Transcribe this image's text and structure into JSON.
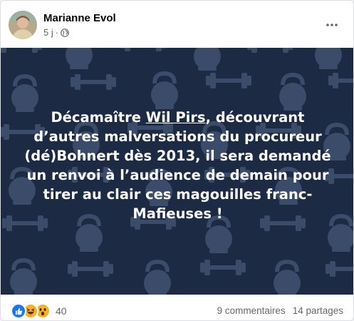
{
  "post": {
    "author": "Marianne Evol",
    "time": "5 j",
    "separator": "·",
    "audience_icon": "globe-icon",
    "more_icon": "more-options-icon",
    "text_before_tag": "Décamaître ",
    "tag": "Wil Pirs",
    "text_after_tag": ", découvrant d’autres malversations du procureur (dé)Bohnert dès 2013, il sera demandé un renvoi à l’audience de demain pour tirer au clair ces magouilles franc-Mafieuses !",
    "background_color": "#1d2a44",
    "pattern_color": "#3b4b6a",
    "text_color": "#ffffff"
  },
  "footer": {
    "reaction_icons": [
      "like-icon",
      "haha-icon",
      "wow-icon"
    ],
    "reaction_count": "40",
    "comments": "9 commentaires",
    "shares": "14 partages"
  }
}
